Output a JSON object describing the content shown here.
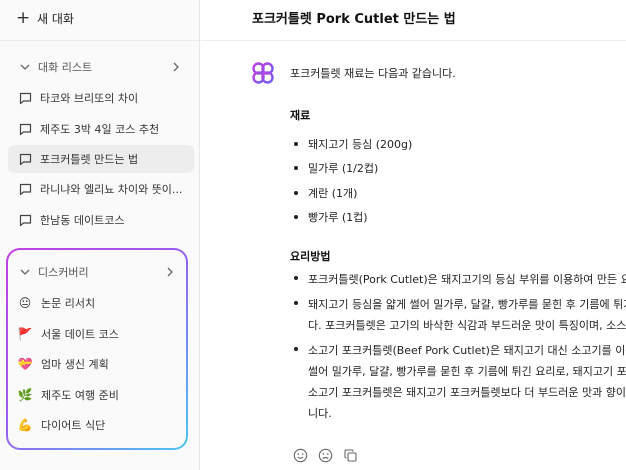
{
  "sidebar": {
    "new_chat_label": "새 대화",
    "chat_list_title": "대화 리스트",
    "chats": [
      {
        "label": "타코와 브리또의 차이"
      },
      {
        "label": "제주도 3박 4일 코스 추천"
      },
      {
        "label": "포크커틀렛 만드는 법",
        "active": true
      },
      {
        "label": "라니냐와 엘리뇨 차이와 뜻이..."
      },
      {
        "label": "한남동 데이트코스"
      }
    ],
    "discovery_title": "디스커버리",
    "discovery_items": [
      {
        "emoji": "😐",
        "label": "논문 리서치"
      },
      {
        "emoji": "🚩",
        "label": "서울 데이트 코스"
      },
      {
        "emoji": "💝",
        "label": "엄마 생신 계획"
      },
      {
        "emoji": "🌿",
        "label": "제주도 여행 준비"
      },
      {
        "emoji": "💪",
        "label": "다이어트 식단"
      }
    ]
  },
  "main": {
    "title": "포크커틀렛 Pork Cutlet 만드는 법",
    "intro": "포크커틀렛 재료는 다음과 같습니다.",
    "ingredients_heading": "재료",
    "ingredients": [
      "돼지고기 등심 (200g)",
      "밀가루 (1/2컵)",
      "계란 (1개)",
      "빵가루 (1컵)"
    ],
    "method_heading": "요리방법",
    "steps": [
      {
        "lines": [
          "포크커틀렛(Pork Cutlet)은 돼지고기의 등심 부위를 이용하여 만든 요리입니다."
        ]
      },
      {
        "lines": [
          "돼지고기 등심을 얇게 썰어 밀가루, 달걀, 빵가루를 묻힌 후 기름에 튀겨 만든 요리입니",
          "다. 포크커틀렛은 고기의 바삭한 식감과 부드러운 맛이 특징이며, 소스와 함께 먹습니다."
        ]
      },
      {
        "lines": [
          "소고기 포크커틀렛(Beef Pork Cutlet)은 돼지고기 대신 소고기를 이용하여 만든 요리로, 얇게",
          "썰어 밀가루, 달걀, 빵가루를 묻힌 후 기름에 튀긴 요리로, 돼지고기 포크커틀렛과 비슷하지만",
          "소고기 포크커틀렛은 돼지고기 포크커틀렛보다 더 부드러운 맛과 향이 나는 것이 특징입",
          "니다."
        ]
      }
    ]
  },
  "colors": {
    "accent_gradient_start": "#c23fe0",
    "accent_gradient_end": "#4ac6f2",
    "active_bg": "#ededed"
  },
  "icons": [
    "plus-icon",
    "chevron-down-icon",
    "chevron-right-icon",
    "chat-bubble-icon",
    "bot-logo-icon",
    "smile-icon",
    "frown-icon",
    "copy-icon"
  ]
}
